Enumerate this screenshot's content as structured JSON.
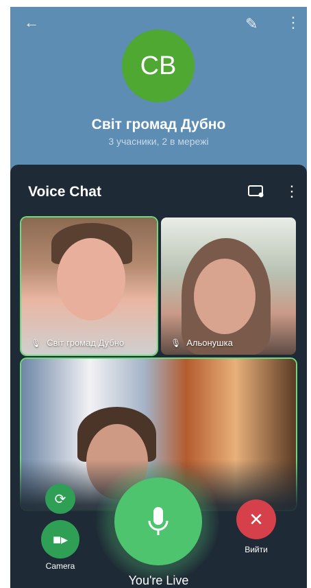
{
  "header": {
    "back_icon": "arrow-left-icon",
    "edit_icon": "pencil-icon",
    "more_icon": "more-vertical-icon",
    "avatar_initials": "CB",
    "avatar_color": "#4fa832",
    "title": "Світ громад Дубно",
    "subtitle": "3 учасники, 2 в мережі"
  },
  "voice_chat": {
    "title": "Voice Chat",
    "screen_icon": "screen-share-icon",
    "more_icon": "more-vertical-icon",
    "participants": [
      {
        "name": "Світ громад Дубно",
        "mic_icon": "microphone-icon",
        "active": true
      },
      {
        "name": "Альонушка",
        "mic_icon": "microphone-icon",
        "active": false
      },
      {
        "name": "",
        "active": true
      }
    ]
  },
  "controls": {
    "flip_icon": "camera-flip-icon",
    "camera_label": "Camera",
    "camera_icon": "video-camera-icon",
    "mic_icon": "microphone-icon",
    "leave_label": "Вийти",
    "leave_icon": "close-icon",
    "live_text": "You're Live",
    "accent": "#4fc46f",
    "leave_color": "#d6404a"
  }
}
